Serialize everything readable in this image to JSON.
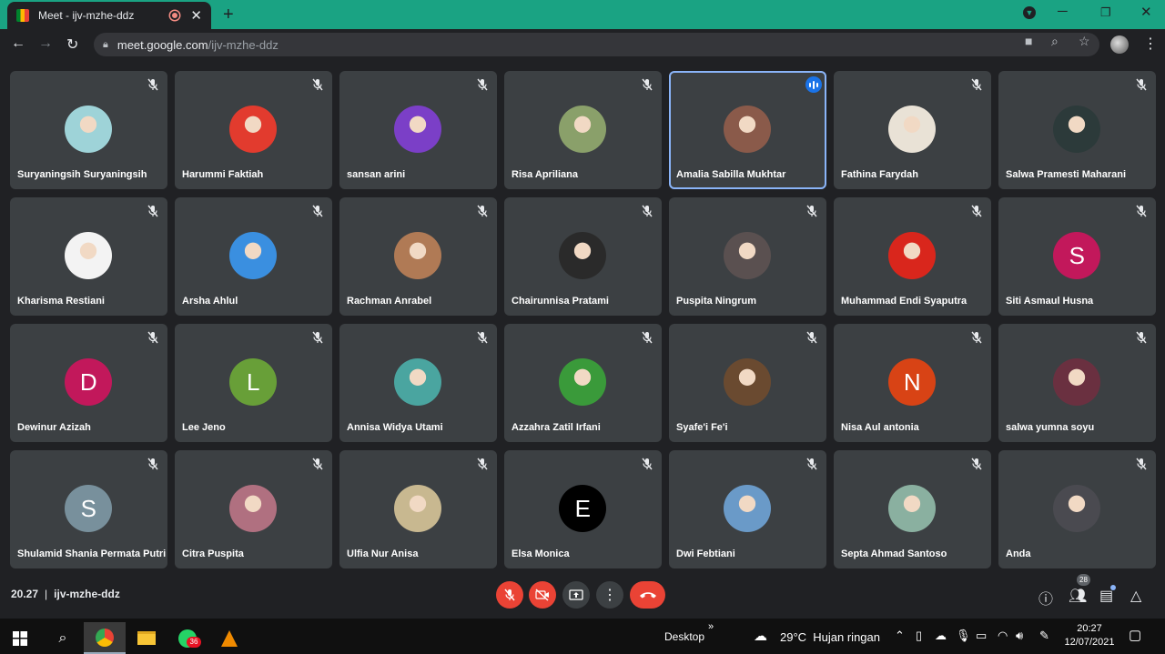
{
  "browser": {
    "tab_title": "Meet - ijv-mzhe-ddz",
    "new_tab": "+",
    "url_host": "meet.google.com",
    "url_path": "/ijv-mzhe-ddz"
  },
  "participants": [
    {
      "name": "Suryaningsih Suryaningsih",
      "avatar": "photo",
      "color": "#9ed3d8"
    },
    {
      "name": "Harummi Faktiah",
      "avatar": "photo",
      "color": "#e23b2e"
    },
    {
      "name": "sansan arini",
      "avatar": "photo",
      "color": "#7b3fc7"
    },
    {
      "name": "Risa Apriliana",
      "avatar": "photo",
      "color": "#8aa06a"
    },
    {
      "name": "Amalia Sabilla Mukhtar",
      "avatar": "photo",
      "color": "#8a5a4a",
      "active": true
    },
    {
      "name": "Fathina Farydah",
      "avatar": "photo",
      "color": "#e9e2d6"
    },
    {
      "name": "Salwa Pramesti Maharani",
      "avatar": "photo",
      "color": "#2c3a3a"
    },
    {
      "name": "Kharisma Restiani",
      "avatar": "photo",
      "color": "#f3f3f3"
    },
    {
      "name": "Arsha Ahlul",
      "avatar": "photo",
      "color": "#3a8fe0"
    },
    {
      "name": "Rachman Anrabel",
      "avatar": "photo",
      "color": "#b07a55"
    },
    {
      "name": "Chairunnisa Pratami",
      "avatar": "photo",
      "color": "#2a2a2a"
    },
    {
      "name": "Puspita Ningrum",
      "avatar": "photo",
      "color": "#5a5050"
    },
    {
      "name": "Muhammad Endi Syaputra",
      "avatar": "photo",
      "color": "#d9261c"
    },
    {
      "name": "Siti Asmaul Husna",
      "avatar": "letter",
      "letter": "S",
      "color": "#c2185b"
    },
    {
      "name": "Dewinur Azizah",
      "avatar": "letter",
      "letter": "D",
      "color": "#c2185b"
    },
    {
      "name": "Lee Jeno",
      "avatar": "letter",
      "letter": "L",
      "color": "#689f38"
    },
    {
      "name": "Annisa Widya Utami",
      "avatar": "photo",
      "color": "#4aa5a0"
    },
    {
      "name": "Azzahra Zatil Irfani",
      "avatar": "photo",
      "color": "#3a9a3a"
    },
    {
      "name": "Syafe'i Fe'i",
      "avatar": "photo",
      "color": "#6a4a30"
    },
    {
      "name": "Nisa Aul antonia",
      "avatar": "letter",
      "letter": "N",
      "color": "#d84315"
    },
    {
      "name": "salwa yumna soyu",
      "avatar": "photo",
      "color": "#6a3040"
    },
    {
      "name": "Shulamid Shania Permata Putri",
      "avatar": "letter",
      "letter": "S",
      "color": "#78909c"
    },
    {
      "name": "Citra Puspita",
      "avatar": "photo",
      "color": "#b07080"
    },
    {
      "name": "Ulfia Nur Anisa",
      "avatar": "photo",
      "color": "#c8b890"
    },
    {
      "name": "Elsa Monica",
      "avatar": "letter",
      "letter": "E",
      "color": "#000000"
    },
    {
      "name": "Dwi Febtiani",
      "avatar": "photo",
      "color": "#6a9ac8"
    },
    {
      "name": "Septa Ahmad Santoso",
      "avatar": "photo",
      "color": "#8ab0a0"
    },
    {
      "name": "Anda",
      "avatar": "photo",
      "color": "#4a4a50"
    }
  ],
  "bottom_bar": {
    "time": "20.27",
    "separator": "|",
    "meeting_code": "ijv-mzhe-ddz",
    "participant_count": "28"
  },
  "taskbar": {
    "desktop_label": "Desktop",
    "chevron": "»",
    "weather": "29°C  Hujan ringan",
    "whatsapp_badge": "36",
    "clock_time": "20:27",
    "clock_date": "12/07/2021"
  },
  "colors": {
    "tile_bg": "#3c4043",
    "page_bg": "#202124",
    "titlebar": "#1aa383",
    "control_red": "#ea4335",
    "active_outline": "#8ab4f8"
  }
}
